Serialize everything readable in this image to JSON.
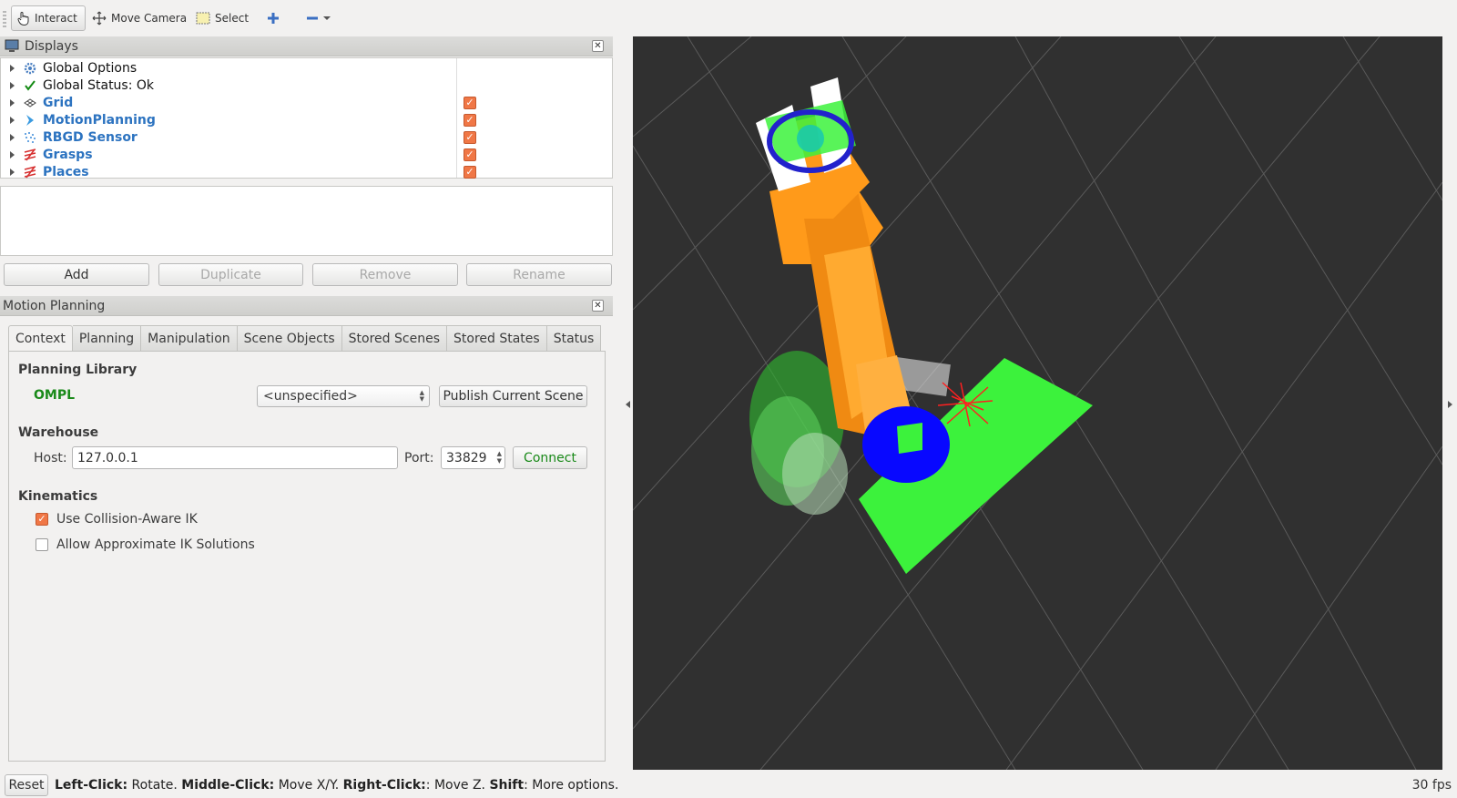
{
  "toolbar": {
    "interact": "Interact",
    "move_camera": "Move Camera",
    "select": "Select",
    "icons": [
      "hand-icon",
      "move-camera-icon",
      "select-box-icon",
      "plus-icon",
      "minus-icon"
    ]
  },
  "displays": {
    "title": "Displays",
    "items": [
      {
        "label": "Global Options",
        "icon": "gear-icon",
        "checked": null,
        "plugin": false
      },
      {
        "label": "Global Status: Ok",
        "icon": "check-icon",
        "checked": null,
        "plugin": false
      },
      {
        "label": "Grid",
        "icon": "grid-icon",
        "checked": true,
        "plugin": true
      },
      {
        "label": "MotionPlanning",
        "icon": "motion-planning-icon",
        "checked": true,
        "plugin": true
      },
      {
        "label": "RBGD Sensor",
        "icon": "point-cloud-icon",
        "checked": true,
        "plugin": true
      },
      {
        "label": "Grasps",
        "icon": "grasp-icon",
        "checked": true,
        "plugin": true
      },
      {
        "label": "Places",
        "icon": "place-icon",
        "checked": true,
        "plugin": true
      }
    ],
    "buttons": {
      "add": "Add",
      "duplicate": "Duplicate",
      "remove": "Remove",
      "rename": "Rename"
    }
  },
  "motion_planning": {
    "title": "Motion Planning",
    "tabs": [
      "Context",
      "Planning",
      "Manipulation",
      "Scene Objects",
      "Stored Scenes",
      "Stored States",
      "Status"
    ],
    "active_tab": "Context",
    "planning_library": {
      "heading": "Planning Library",
      "library": "OMPL",
      "planner": "<unspecified>",
      "publish_button": "Publish Current Scene"
    },
    "warehouse": {
      "heading": "Warehouse",
      "host_label": "Host:",
      "host": "127.0.0.1",
      "port_label": "Port:",
      "port": "33829",
      "connect_button": "Connect"
    },
    "kinematics": {
      "heading": "Kinematics",
      "collision_aware_label": "Use Collision-Aware IK",
      "collision_aware_checked": true,
      "approx_label": "Allow Approximate IK Solutions",
      "approx_checked": false
    }
  },
  "status_bar": {
    "reset_button": "Reset",
    "left_click": "Left-Click:",
    "rotate": " Rotate. ",
    "middle_click": "Middle-Click:",
    "move_xy": " Move X/Y. ",
    "right_click": "Right-Click:",
    "move_z": ": Move Z. ",
    "shift": "Shift",
    "more": ": More options.",
    "fps": "30 fps"
  },
  "colors": {
    "viewport_bg": "#303030",
    "checkbox": "#f07746",
    "plugin_label": "#2c73c0",
    "ompl": "#1a8a1a",
    "connect": "#1a8a1a"
  }
}
